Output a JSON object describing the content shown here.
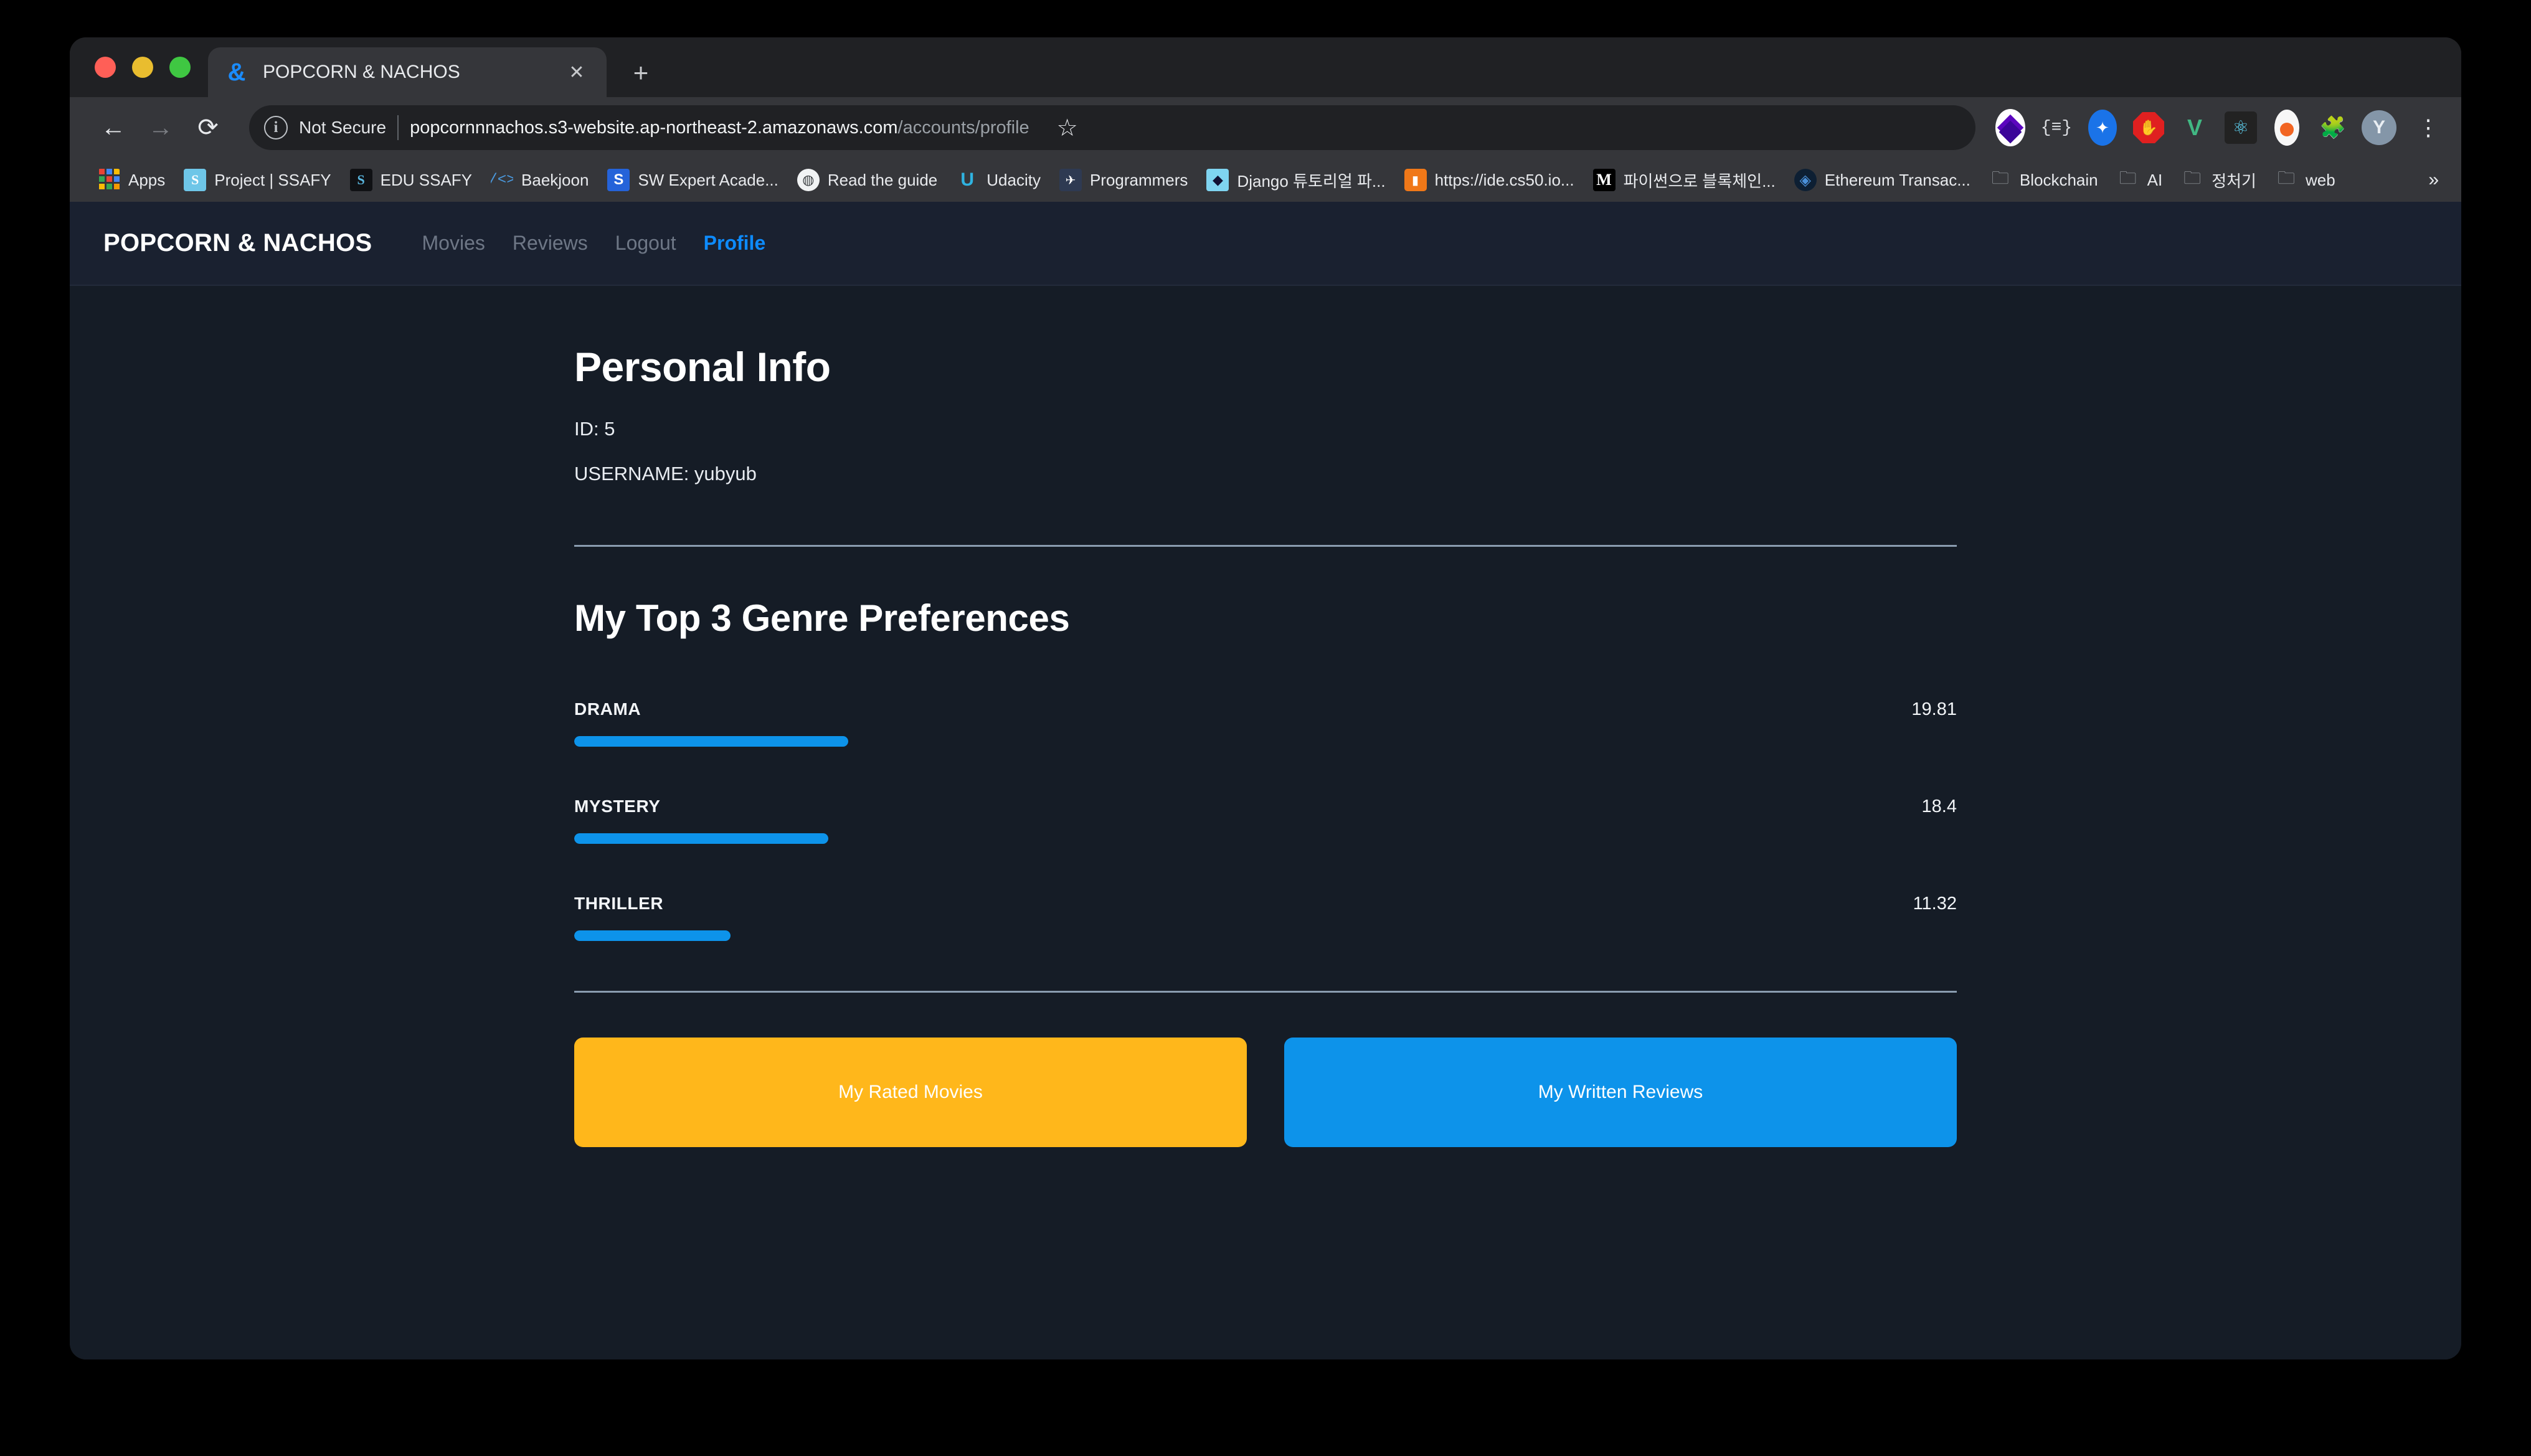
{
  "browser": {
    "tab": {
      "title": "POPCORN & NACHOS",
      "favicon": "ampersand-icon",
      "close": "✕"
    },
    "new_tab": "+",
    "nav": {
      "back": "←",
      "forward": "→",
      "reload": "⟳"
    },
    "omnibox": {
      "security_label": "Not Secure",
      "info_icon": "i",
      "url_host": "popcornnnachos.s3-website.ap-northeast-2.amazonaws.com",
      "url_path": "/accounts/profile",
      "star": "☆"
    },
    "extensions": [
      {
        "name": "metamask-icon",
        "glyph": ""
      },
      {
        "name": "json-formatter-icon",
        "glyph": "{≡}"
      },
      {
        "name": "blue-app-icon",
        "glyph": "✦"
      },
      {
        "name": "adblock-icon",
        "glyph": "✋"
      },
      {
        "name": "vue-devtools-icon",
        "glyph": "V"
      },
      {
        "name": "react-devtools-icon",
        "glyph": "⚛"
      },
      {
        "name": "orange-drop-icon",
        "glyph": ""
      },
      {
        "name": "extensions-puzzle-icon",
        "glyph": "🧩"
      },
      {
        "name": "profile-avatar",
        "glyph": "Y"
      },
      {
        "name": "chrome-menu-icon",
        "glyph": "⋮"
      }
    ],
    "bookmarks": [
      {
        "label": "Apps",
        "icon": "apps-grid-icon"
      },
      {
        "label": "Project | SSAFY",
        "icon": "ssafy-icon"
      },
      {
        "label": "EDU SSAFY",
        "icon": "edu-ssafy-icon"
      },
      {
        "label": "Baekjoon",
        "icon": "baekjoon-icon"
      },
      {
        "label": "SW Expert Acade...",
        "icon": "sw-expert-icon"
      },
      {
        "label": "Read the guide",
        "icon": "guide-icon"
      },
      {
        "label": "Udacity",
        "icon": "udacity-icon"
      },
      {
        "label": "Programmers",
        "icon": "programmers-icon"
      },
      {
        "label": "Django 튜토리얼 파...",
        "icon": "django-icon"
      },
      {
        "label": "https://ide.cs50.io...",
        "icon": "cs50-icon"
      },
      {
        "label": "파이썬으로 블록체인...",
        "icon": "medium-icon"
      },
      {
        "label": "Ethereum Transac...",
        "icon": "ethereum-icon"
      },
      {
        "label": "Blockchain",
        "icon": "folder-icon"
      },
      {
        "label": "AI",
        "icon": "folder-icon"
      },
      {
        "label": "정처기",
        "icon": "folder-icon"
      },
      {
        "label": "web",
        "icon": "folder-icon"
      }
    ],
    "bookmarks_overflow": "»"
  },
  "site": {
    "brand": "POPCORN & NACHOS",
    "nav_links": [
      {
        "label": "Movies",
        "active": false
      },
      {
        "label": "Reviews",
        "active": false
      },
      {
        "label": "Logout",
        "active": false
      },
      {
        "label": "Profile",
        "active": true
      }
    ],
    "personal_info": {
      "heading": "Personal Info",
      "id_line": "ID: 5",
      "username_line": "USERNAME: yubyub"
    },
    "genres": {
      "heading": "My Top 3 Genre Preferences",
      "items": [
        {
          "name": "DRAMA",
          "value": "19.81",
          "bar_percent": "19.81%"
        },
        {
          "name": "MYSTERY",
          "value": "18.4",
          "bar_percent": "18.4%"
        },
        {
          "name": "THRILLER",
          "value": "11.32",
          "bar_percent": "11.32%"
        }
      ]
    },
    "buttons": {
      "rated_movies": "My Rated Movies",
      "written_reviews": "My Written Reviews"
    },
    "colors": {
      "accent_blue": "#0d93ea",
      "accent_yellow": "#ffb71b",
      "page_bg": "#151c26",
      "nav_bg": "#1a2130"
    }
  },
  "chart_data": {
    "type": "bar",
    "title": "My Top 3 Genre Preferences",
    "categories": [
      "DRAMA",
      "MYSTERY",
      "THRILLER"
    ],
    "values": [
      19.81,
      18.4,
      11.32
    ],
    "xlabel": "",
    "ylabel": "",
    "ylim": [
      0,
      100
    ],
    "orientation": "horizontal",
    "grid": false,
    "legend": "none",
    "bar_color": "#0d93ea"
  }
}
